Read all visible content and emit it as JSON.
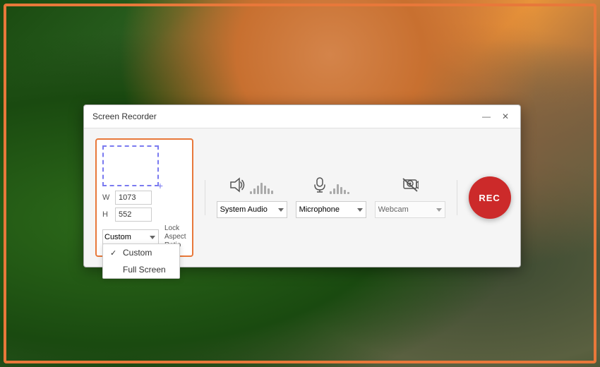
{
  "window": {
    "title": "Screen Recorder",
    "minimize_label": "—",
    "close_label": "✕"
  },
  "screen_selector": {
    "width_label": "W",
    "height_label": "H",
    "width_value": "1073",
    "height_value": "552",
    "mode_selected": "Custom",
    "lock_ratio_label": "Lock Aspect\nRatio",
    "dropdown_open": true
  },
  "dropdown_items": [
    {
      "label": "Custom",
      "checked": true
    },
    {
      "label": "Full Screen",
      "checked": false
    }
  ],
  "audio": {
    "system_label": "System Audio",
    "mic_label": "Microphone",
    "webcam_label": "Webcam",
    "system_options": [
      "System Audio"
    ],
    "mic_options": [
      "Microphone"
    ],
    "webcam_options": [
      "Webcam"
    ]
  },
  "rec_button": {
    "label": "REC"
  },
  "volume_bars": [
    4,
    8,
    12,
    16,
    12,
    8,
    5
  ],
  "mic_bars": [
    4,
    8,
    14,
    10,
    6,
    3
  ],
  "colors": {
    "orange_border": "#e8783a",
    "purple": "#7a7af0",
    "rec_red": "#cc2a2a"
  }
}
